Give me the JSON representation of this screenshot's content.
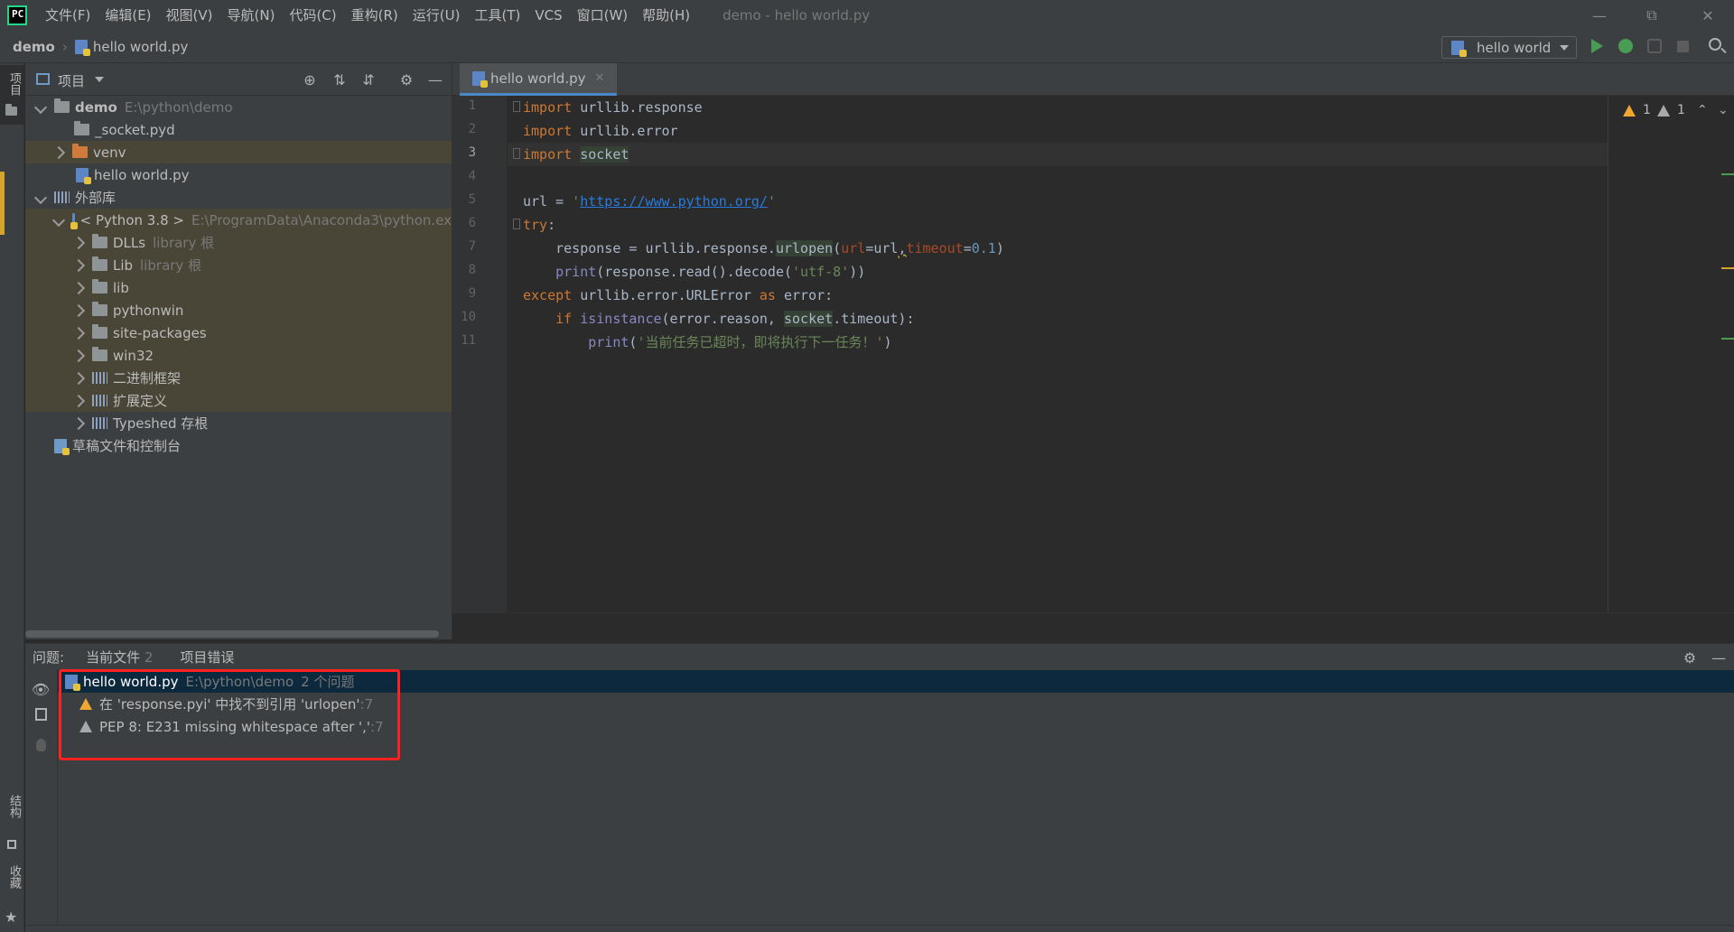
{
  "titlebar": {
    "menu": [
      "文件(F)",
      "编辑(E)",
      "视图(V)",
      "导航(N)",
      "代码(C)",
      "重构(R)",
      "运行(U)",
      "工具(T)",
      "VCS",
      "窗口(W)",
      "帮助(H)"
    ],
    "window_title": "demo - hello world.py"
  },
  "navbar": {
    "project": "demo",
    "file": "hello world.py",
    "run_config": "hello world"
  },
  "leftstripe": {
    "project_label": "项目",
    "structure_label": "结构",
    "favorites_label": "收藏"
  },
  "project_panel": {
    "title": "项目",
    "tree": [
      {
        "label": "demo",
        "path": "E:\\python\\demo"
      },
      {
        "label": "_socket.pyd"
      },
      {
        "label": "venv"
      },
      {
        "label": "hello world.py"
      },
      {
        "label": "外部库"
      },
      {
        "label": "< Python 3.8 >",
        "path": "E:\\ProgramData\\Anaconda3\\python.ex"
      },
      {
        "label": "DLLs",
        "note": "library 根"
      },
      {
        "label": "Lib",
        "note": "library 根"
      },
      {
        "label": "lib"
      },
      {
        "label": "pythonwin"
      },
      {
        "label": "site-packages"
      },
      {
        "label": "win32"
      },
      {
        "label": "二进制框架"
      },
      {
        "label": "扩展定义"
      },
      {
        "label": "Typeshed 存根"
      },
      {
        "label": "草稿文件和控制台"
      }
    ]
  },
  "editor": {
    "tab": "hello world.py",
    "line_numbers": [
      "1",
      "2",
      "3",
      "4",
      "5",
      "6",
      "7",
      "8",
      "9",
      "10",
      "11"
    ],
    "code": {
      "l1_kw": "import",
      "l1_rest": " urllib.response",
      "l2_kw": "import",
      "l2_rest": " urllib.error",
      "l3_kw": "import",
      "l3_rest": "socket",
      "l5_pre": "url = ",
      "l5_q1": "'",
      "l5_url": "https://www.python.org/",
      "l5_q2": "'",
      "l6_kw": "try",
      "l6_rest": ":",
      "l7_pre": "    response = urllib.response.",
      "l7_fn": "urlopen",
      "l7_p1": "(",
      "l7_param1": "url",
      "l7_eq1": "=url",
      "l7_comma": ",",
      "l7_param2": "timeout",
      "l7_eq2": "=",
      "l7_num": "0.1",
      "l7_end": ")",
      "l8_pre": "    ",
      "l8_fn": "print",
      "l8_mid": "(response.read().decode(",
      "l8_str": "'utf-8'",
      "l8_end": "))",
      "l9_kw": "except",
      "l9_mid": " urllib.error.URLError ",
      "l9_kw2": "as",
      "l9_end": " error:",
      "l10_pre": "    ",
      "l10_kw": "if",
      "l10_sp": " ",
      "l10_fn": "isinstance",
      "l10_mid": "(error.reason, ",
      "l10_sock": "socket",
      "l10_end": ".timeout):",
      "l11_pre": "        ",
      "l11_fn": "print",
      "l11_p": "(",
      "l11_str": "'当前任务已超时，即将执行下一任务！'",
      "l11_end": ")"
    },
    "inspection_warn": "1",
    "inspection_weak": "1"
  },
  "problems": {
    "label": "问题:",
    "tab_current": "当前文件",
    "tab_current_count": "2",
    "tab_project": "项目错误",
    "file": "hello world.py",
    "file_path": "E:\\python\\demo",
    "file_count": "2 个问题",
    "items": [
      {
        "text": "在 'response.pyi' 中找不到引用 'urlopen'",
        "line": ":7"
      },
      {
        "text": "PEP 8: E231 missing whitespace after ','",
        "line": ":7"
      }
    ]
  },
  "colors": {
    "accent": "#4a88c7",
    "warning": "#f0a732",
    "highlight_box": "#ff2020",
    "run_green": "#499c54"
  }
}
